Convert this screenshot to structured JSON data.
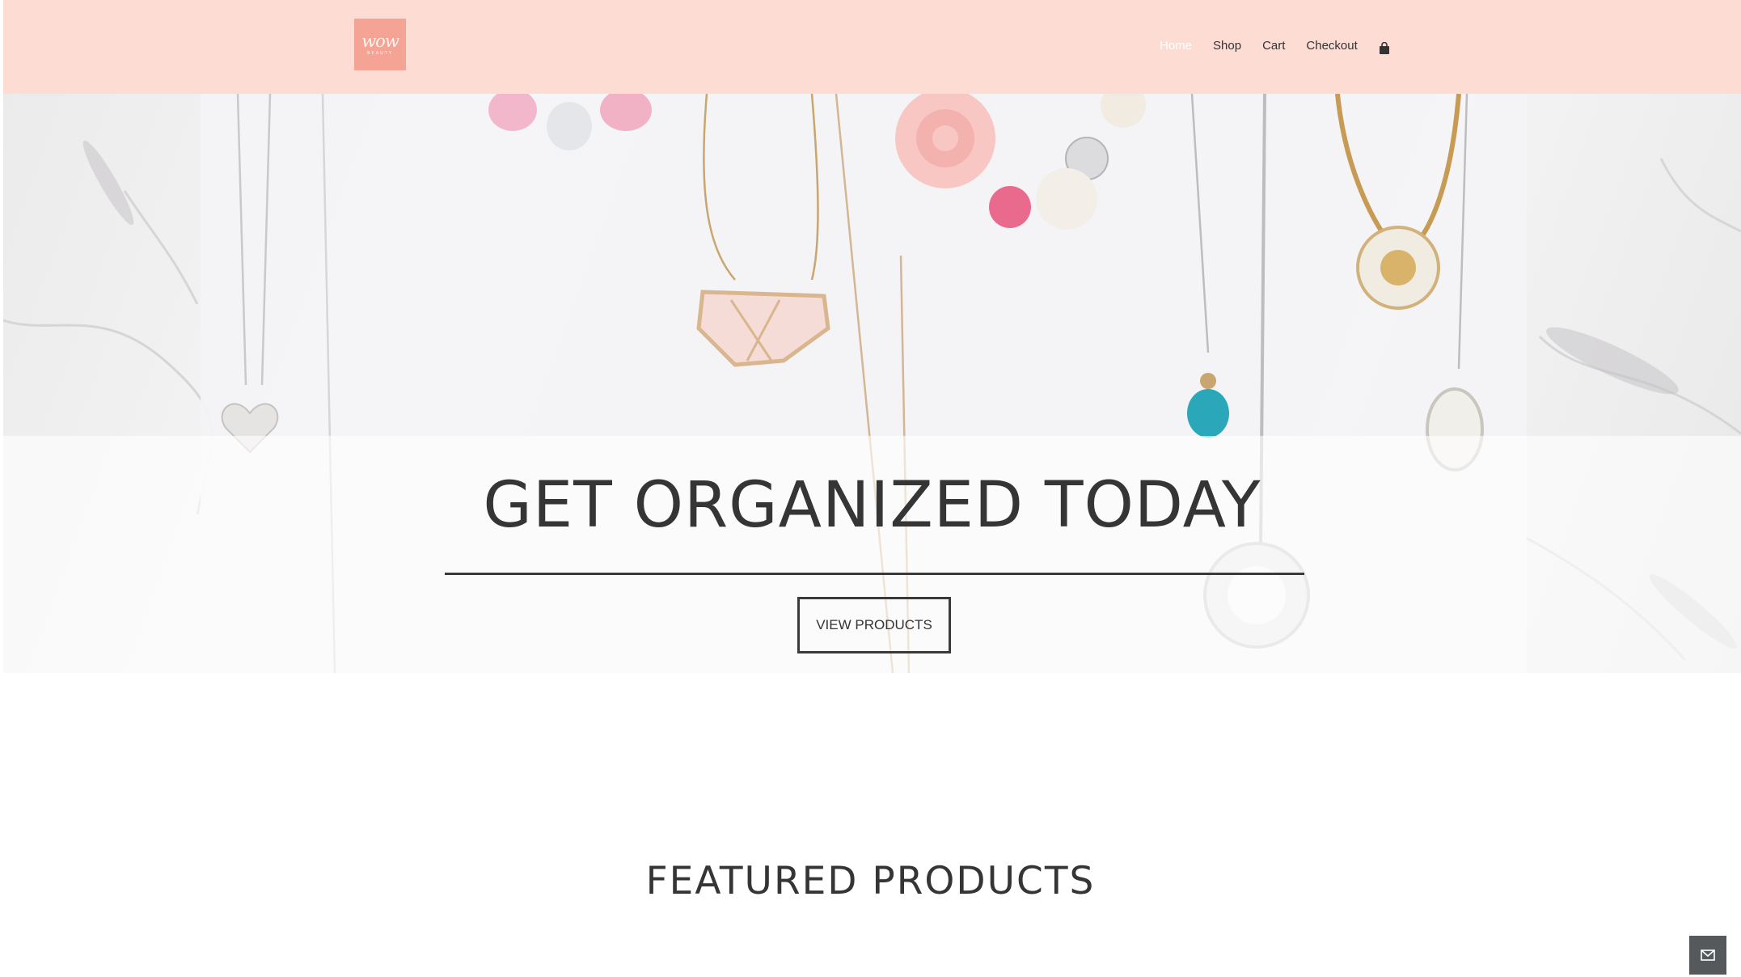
{
  "header": {
    "logo": {
      "script_text": "wow",
      "sub_text": "BEAUTY"
    },
    "nav": {
      "items": [
        "Home",
        "Shop",
        "Cart",
        "Checkout"
      ],
      "active": "Home",
      "cart_icon": "shopping-bag-icon"
    }
  },
  "hero": {
    "title": "GET ORGANIZED TODAY",
    "button_label": "VIEW PRODUCTS",
    "image_subject": "necklaces on marble"
  },
  "featured": {
    "title": "FEATURED PRODUCTS"
  },
  "floating": {
    "contact_icon": "mail-icon"
  },
  "colors": {
    "header_bg": "#fddcd4",
    "logo_bg": "#f5a394",
    "text_dark": "#353535",
    "contact_bg": "#55595c"
  }
}
